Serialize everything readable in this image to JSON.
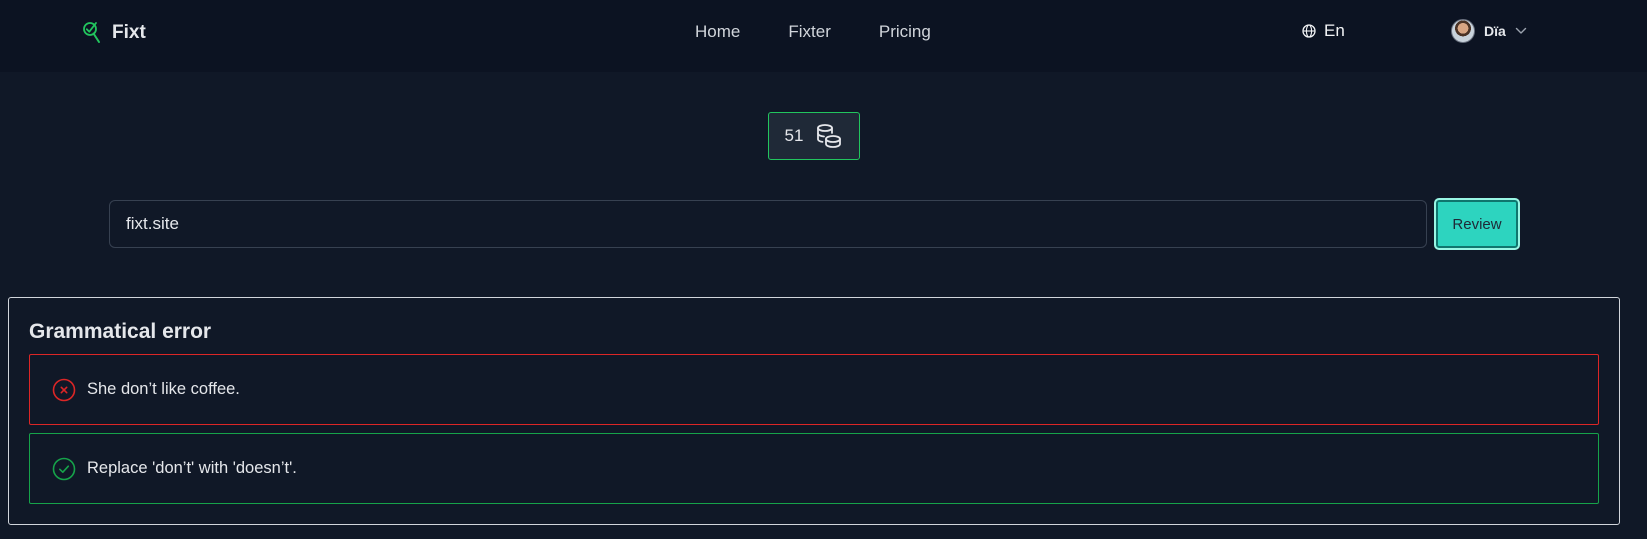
{
  "header": {
    "brand": "Fixt",
    "nav": [
      {
        "label": "Home"
      },
      {
        "label": "Fixter"
      },
      {
        "label": "Pricing"
      }
    ],
    "language": "En",
    "user_name": "Dïa"
  },
  "credits": {
    "count": "51",
    "icon": "coins-icon"
  },
  "search": {
    "value": "fixt.site",
    "button_label": "Review"
  },
  "result": {
    "title": "Grammatical error",
    "error_text": "She don’t like coffee.",
    "fix_text": "Replace 'don’t' with 'doesn’t'."
  },
  "colors": {
    "background": "#101827",
    "accent": "#2dd4bf",
    "error": "#dc2626",
    "success": "#16a34a"
  }
}
